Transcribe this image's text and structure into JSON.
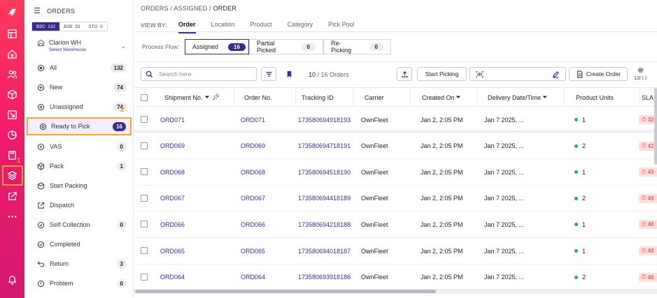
{
  "rail": {
    "step_number": "1",
    "icons": [
      "logo-icon",
      "dashboard-icon",
      "home-icon",
      "users-icon",
      "box-icon",
      "transfer-icon",
      "report-icon",
      "clipboard-icon",
      "layers-icon",
      "external-link-icon",
      "more-icon",
      "bell-icon"
    ]
  },
  "sidebar": {
    "title": "ORDERS",
    "segments": [
      {
        "label": "B2C",
        "count": "132"
      },
      {
        "label": "B2B",
        "count": "33"
      },
      {
        "label": "STO",
        "count": "0"
      }
    ],
    "warehouse": {
      "name": "Clarion WH",
      "sub": "Select Warehouse"
    },
    "step_number": "2",
    "items": [
      {
        "label": "All",
        "count": "132"
      },
      {
        "label": "New",
        "count": "74"
      },
      {
        "label": "Unassigned",
        "count": "74"
      },
      {
        "label": "Ready to Pick",
        "count": "16"
      },
      {
        "label": "VAS",
        "count": "0"
      },
      {
        "label": "Pack",
        "count": "1"
      },
      {
        "label": "Start Packing",
        "count": ""
      },
      {
        "label": "Dispatch",
        "count": ""
      },
      {
        "label": "Self Collection",
        "count": "0"
      },
      {
        "label": "Completed",
        "count": ""
      },
      {
        "label": "Return",
        "count": "3"
      },
      {
        "label": "Problem",
        "count": "0"
      }
    ]
  },
  "breadcrumb": {
    "a": "ORDERS",
    "sep": "/",
    "b": "ASSIGNED",
    "c": "ORDER"
  },
  "viewby": {
    "label": "VIEW BY:",
    "tabs": [
      "Order",
      "Location",
      "Product",
      "Category",
      "Pick Pool"
    ]
  },
  "process_flow": {
    "label": "Process Flow:",
    "items": [
      {
        "label": "Assigned",
        "count": "16"
      },
      {
        "label": "Partial Picked",
        "count": "0"
      },
      {
        "label": "Re-Picking",
        "count": "0"
      }
    ]
  },
  "toolbar": {
    "search_placeholder": "Search here",
    "count_shown": "10",
    "count_total": "/ 16 Orders",
    "start_picking": "Start Picking",
    "create_order": "Create Order",
    "pager": "13",
    "pager_total": "/13"
  },
  "table": {
    "columns": [
      "Shipment No.",
      "Order No.",
      "Tracking ID",
      "Carrier",
      "Created On",
      "Delivery Date/Time",
      "Product Units",
      "SLA"
    ],
    "rows": [
      {
        "shipment": "ORD071",
        "order": "ORD071",
        "tracking": "173580694918193",
        "carrier": "OwnFleet",
        "created": "Jan 2, 2:05 PM",
        "delivery": "Jan 7 2025, ...",
        "units": "1",
        "sla": "32"
      },
      {
        "shipment": "ORD069",
        "order": "ORD069",
        "tracking": "173580694718191",
        "carrier": "OwnFleet",
        "created": "Jan 2, 2:05 PM",
        "delivery": "Jan 7 2025, ...",
        "units": "2",
        "sla": "42"
      },
      {
        "shipment": "ORD068",
        "order": "ORD068",
        "tracking": "173580694518190",
        "carrier": "OwnFleet",
        "created": "Jan 2, 2:05 PM",
        "delivery": "Jan 7 2025, ...",
        "units": "1",
        "sla": "43"
      },
      {
        "shipment": "ORD067",
        "order": "ORD067",
        "tracking": "173580694418189",
        "carrier": "OwnFleet",
        "created": "Jan 2, 2:05 PM",
        "delivery": "Jan 7 2025, ...",
        "units": "2",
        "sla": "48"
      },
      {
        "shipment": "ORD066",
        "order": "ORD066",
        "tracking": "173580694218188",
        "carrier": "OwnFleet",
        "created": "Jan 2, 2:05 PM",
        "delivery": "Jan 7 2025, ...",
        "units": "1",
        "sla": "48"
      },
      {
        "shipment": "ORD065",
        "order": "ORD065",
        "tracking": "173580694018187",
        "carrier": "OwnFleet",
        "created": "Jan 2, 2:05 PM",
        "delivery": "Jan 7 2025, ...",
        "units": "1",
        "sla": "48"
      },
      {
        "shipment": "ORD064",
        "order": "ORD064",
        "tracking": "173580693918186",
        "carrier": "OwnFleet",
        "created": "Jan 2, 2:05 PM",
        "delivery": "Jan 7 2025, ...",
        "units": "2",
        "sla": "48"
      }
    ]
  },
  "colors": {
    "accent": "#3a2a8c",
    "brand": "#f21b6a",
    "highlight": "#f2a23c",
    "status_green": "#2ea44f",
    "sla_red": "#e03131"
  }
}
